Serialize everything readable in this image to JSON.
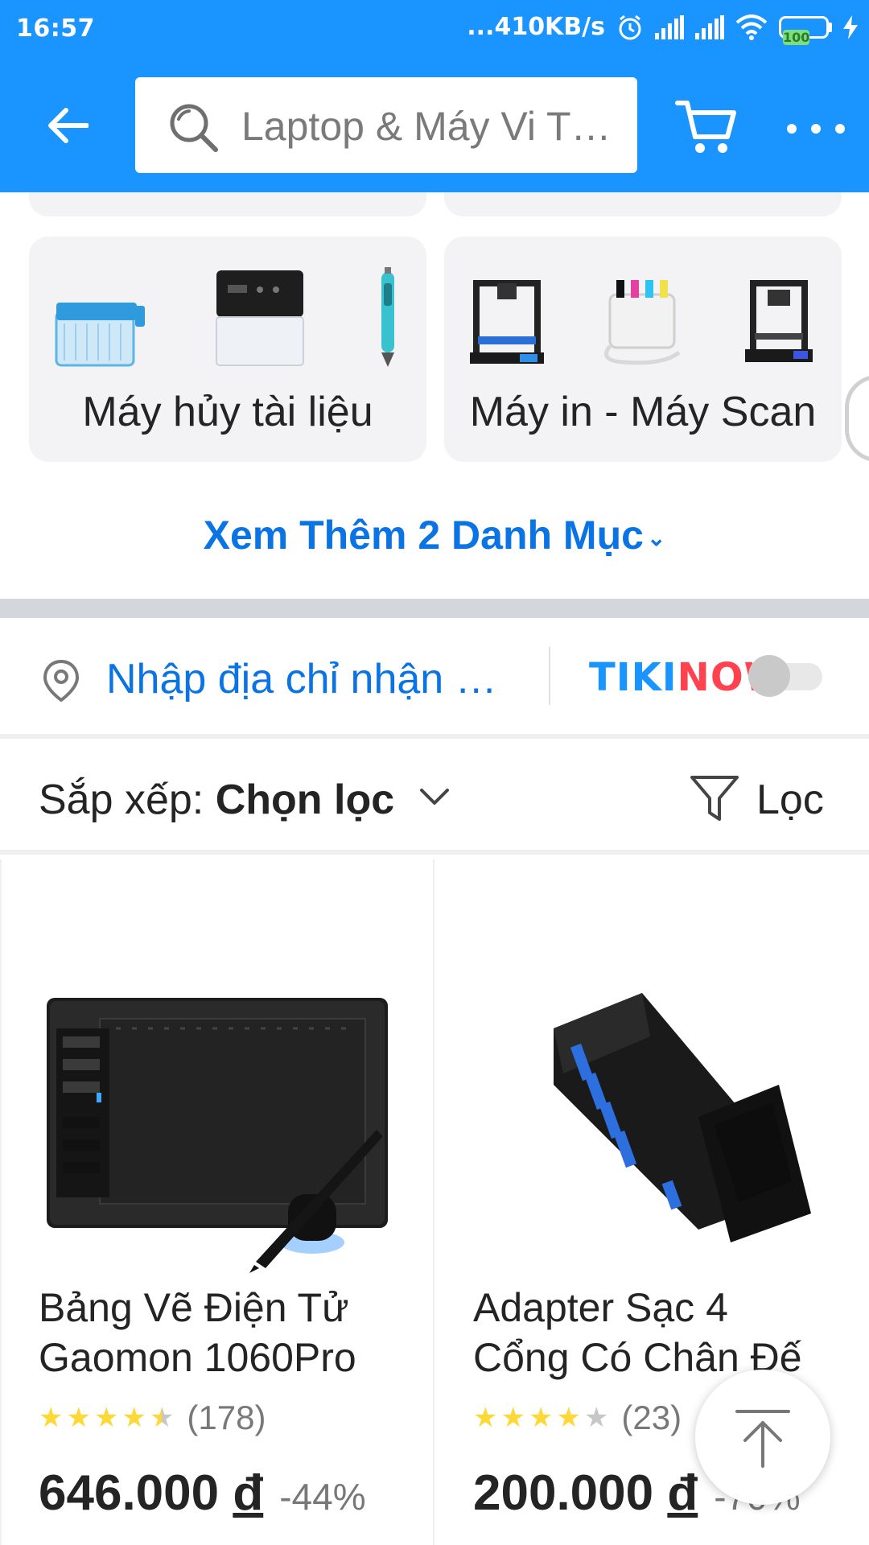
{
  "status_bar": {
    "time": "16:57",
    "network_speed": "...410KB/s",
    "battery": "100"
  },
  "header": {
    "search_placeholder": "Laptop & Máy Vi Tính",
    "icons": [
      "back-arrow-icon",
      "search-icon",
      "cart-icon",
      "more-icon"
    ]
  },
  "categories": [
    {
      "label": "Máy hủy tài liệu"
    },
    {
      "label": "Máy in - Máy Scan"
    }
  ],
  "see_more": {
    "label": "Xem Thêm 2 Danh Mục",
    "chevron": "⌄"
  },
  "address": {
    "placeholder": "Nhập địa chỉ nhận hàng",
    "tikinow_tiki": "TIKI",
    "tikinow_now": "NOW",
    "toggle_on": false
  },
  "sort": {
    "prefix": "Sắp xếp: ",
    "value": "Chọn lọc",
    "filter_label": "Lọc"
  },
  "products": [
    {
      "name_line1": "Bảng Vẽ Điện Tử",
      "name_line2": "Gaomon 1060Pro",
      "rating": 4.5,
      "review_count": "(178)",
      "price": "646.000",
      "currency": "đ",
      "discount": "-44%"
    },
    {
      "name_line1": "Adapter Sạc 4",
      "name_line2": "Cổng Có Chân Đế",
      "rating": 4,
      "review_count": "(23)",
      "price": "200.000",
      "currency": "đ",
      "discount": "-70%"
    }
  ],
  "colors": {
    "header_bg": "#1a94ff",
    "link_blue": "#0b74e5",
    "star_yellow": "#fdd836",
    "tiki_blue": "#1a94ff",
    "now_red": "#ff424e"
  }
}
